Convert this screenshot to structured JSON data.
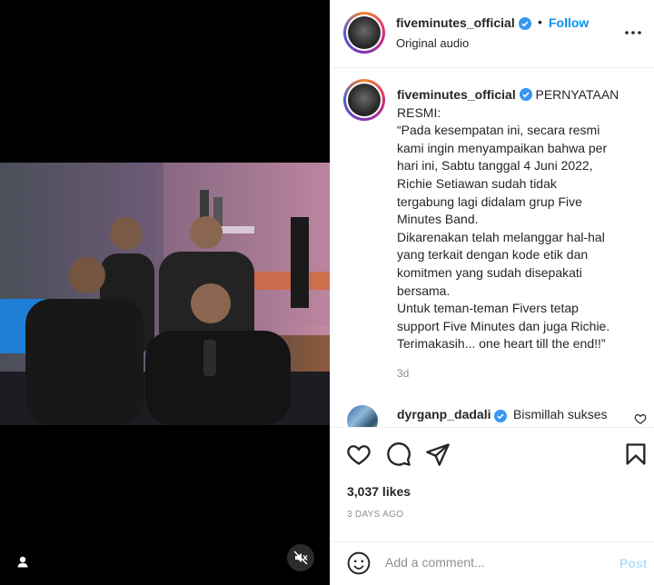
{
  "post": {
    "author": "fiveminutes_official",
    "follow_label": "Follow",
    "separator": "•",
    "audio": "Original audio"
  },
  "caption": {
    "author": "fiveminutes_official",
    "lines": [
      "PERNYATAAN",
      "RESMI:",
      "“Pada kesempatan ini, secara resmi",
      "kami ingin menyampaikan bahwa per",
      "hari ini, Sabtu tanggal 4 Juni 2022,",
      "Richie Setiawan sudah tidak",
      "tergabung lagi didalam grup Five",
      "Minutes Band.",
      "Dikarenakan telah melanggar hal-hal",
      "yang terkait dengan kode etik dan",
      "komitmen yang sudah disepakati",
      "bersama.",
      "Untuk teman-teman Fivers tetap",
      "support Five Minutes dan juga Richie.",
      "Terimakasih... one heart till the end!!”"
    ],
    "time": "3d"
  },
  "comment": {
    "user": "dyrganp_dadali",
    "text": "Bismillah sukses"
  },
  "stats": {
    "likes": "3,037 likes",
    "ago": "3 DAYS AGO"
  },
  "composer": {
    "placeholder": "Add a comment...",
    "post_label": "Post"
  },
  "colors": {
    "accent": "#0095f6",
    "verified": "#3897f0",
    "muted": "#8e8e8e"
  }
}
